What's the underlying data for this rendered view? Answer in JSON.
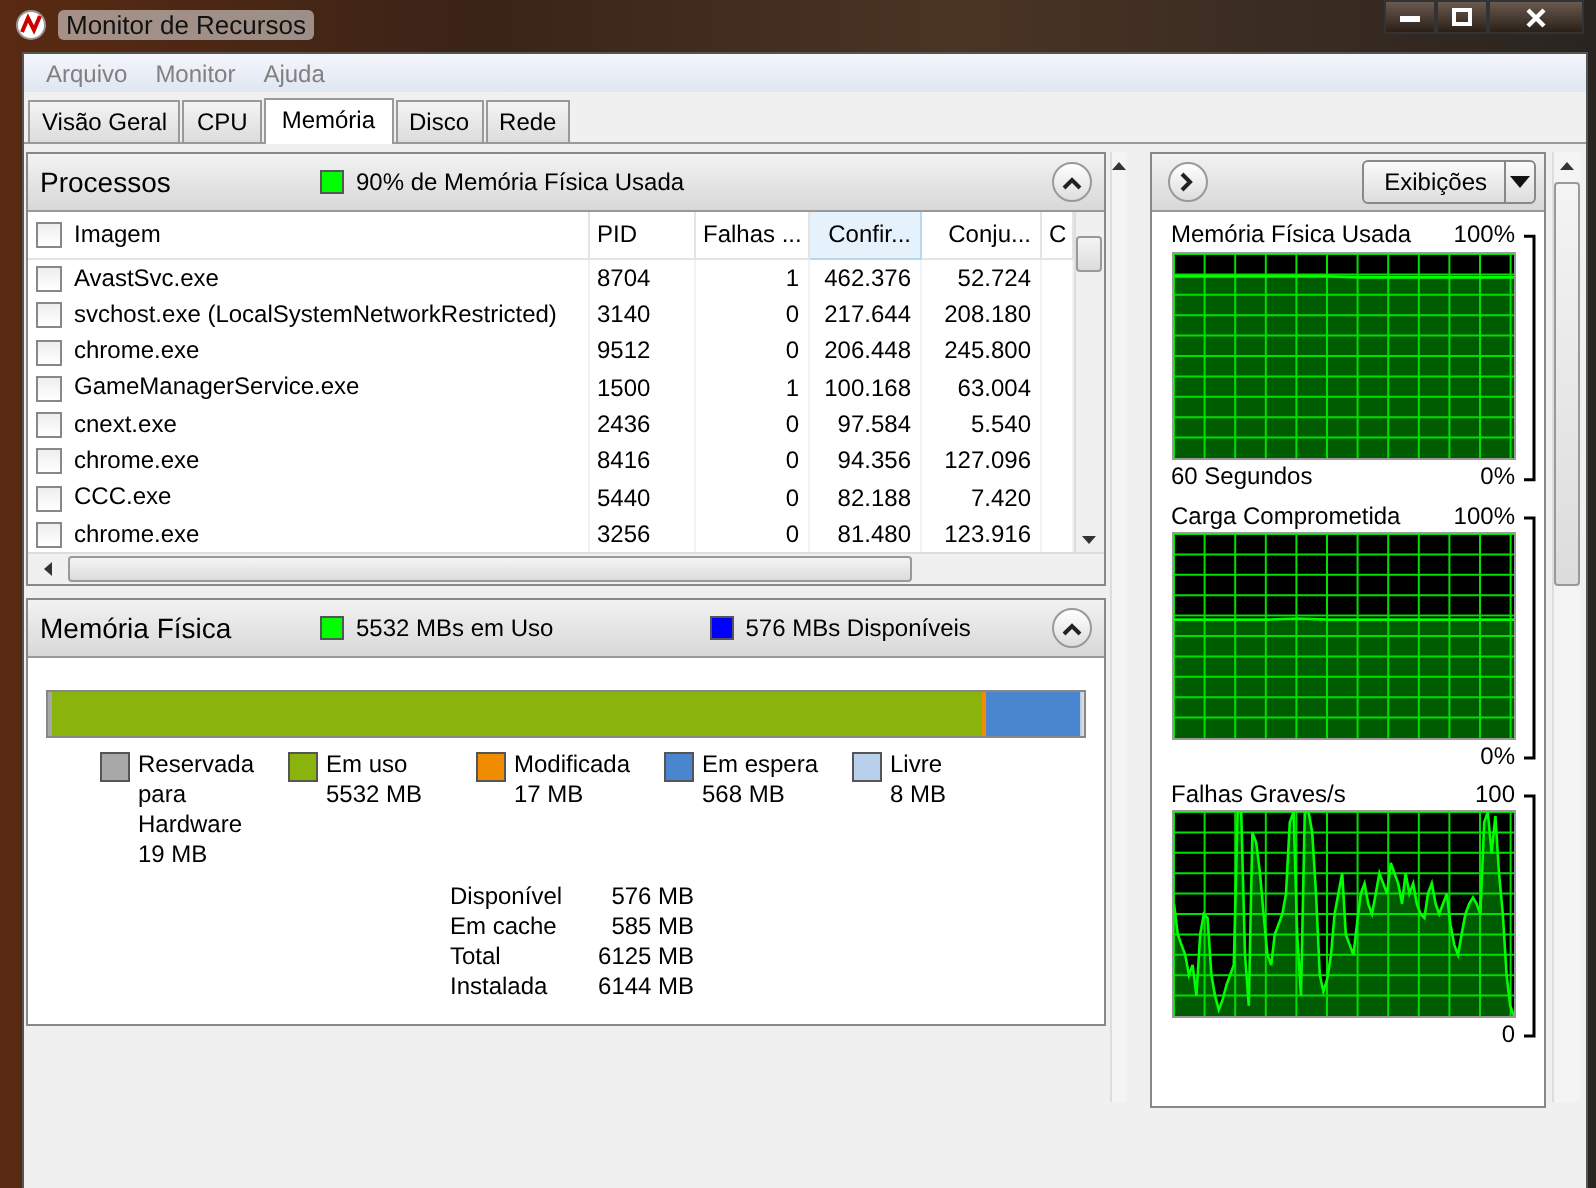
{
  "window": {
    "title": "Monitor de Recursos"
  },
  "menu": [
    "Arquivo",
    "Monitor",
    "Ajuda"
  ],
  "tabs": [
    {
      "label": "Visão Geral",
      "selected": false
    },
    {
      "label": "CPU",
      "selected": false
    },
    {
      "label": "Memória",
      "selected": true
    },
    {
      "label": "Disco",
      "selected": false
    },
    {
      "label": "Rede",
      "selected": false
    }
  ],
  "processes": {
    "title": "Processos",
    "indicator": {
      "label": "90% de Memória Física Usada",
      "color": "#00ff00"
    },
    "expanded": true,
    "columns": [
      {
        "label": "Imagem",
        "sorted": false
      },
      {
        "label": "PID",
        "sorted": false
      },
      {
        "label": "Falhas ...",
        "sorted": false
      },
      {
        "label": "Confir...",
        "sorted": true
      },
      {
        "label": "Conju...",
        "sorted": false
      },
      {
        "label": "C",
        "sorted": false
      }
    ],
    "rows": [
      {
        "checked": false,
        "cells": [
          "AvastSvc.exe",
          "8704",
          "1",
          "462.376",
          "52.724"
        ]
      },
      {
        "checked": false,
        "cells": [
          "svchost.exe (LocalSystemNetworkRestricted)",
          "3140",
          "0",
          "217.644",
          "208.180"
        ]
      },
      {
        "checked": false,
        "cells": [
          "chrome.exe",
          "9512",
          "0",
          "206.448",
          "245.800"
        ]
      },
      {
        "checked": false,
        "cells": [
          "GameManagerService.exe",
          "1500",
          "1",
          "100.168",
          "63.004"
        ]
      },
      {
        "checked": false,
        "cells": [
          "cnext.exe",
          "2436",
          "0",
          "97.584",
          "5.540"
        ]
      },
      {
        "checked": false,
        "cells": [
          "chrome.exe",
          "8416",
          "0",
          "94.356",
          "127.096"
        ]
      },
      {
        "checked": false,
        "cells": [
          "CCC.exe",
          "5440",
          "0",
          "82.188",
          "7.420"
        ]
      },
      {
        "checked": false,
        "cells": [
          "chrome.exe",
          "3256",
          "0",
          "81.480",
          "123.916"
        ]
      }
    ]
  },
  "physical_memory": {
    "title": "Memória Física",
    "expanded": true,
    "indicators": [
      {
        "label": "5532 MBs em Uso",
        "color": "#00ff00"
      },
      {
        "label": "576 MBs Disponíveis",
        "color": "#0000ff"
      }
    ],
    "segments": [
      {
        "label": "Reservada para Hardware",
        "value": "19 MB",
        "color": "#a8a8a8",
        "level": 0.003
      },
      {
        "label": "Em uso",
        "value": "5532 MB",
        "color": "#8ab40c",
        "level": 0.9
      },
      {
        "label": "Modificada",
        "value": "17 MB",
        "color": "#f08c00",
        "level": 0.003
      },
      {
        "label": "Em espera",
        "value": "568 MB",
        "color": "#4a86cf",
        "level": 0.092
      },
      {
        "label": "Livre",
        "value": "8 MB",
        "color": "#b8d0ec",
        "level": 0.002
      }
    ],
    "stats": [
      {
        "label": "Disponível",
        "value": "576 MB"
      },
      {
        "label": "Em cache",
        "value": "585 MB"
      },
      {
        "label": "Total",
        "value": "6125 MB"
      },
      {
        "label": "Instalada",
        "value": "6144 MB"
      }
    ]
  },
  "graphs_panel": {
    "views_button": "Exibições",
    "graphs": [
      {
        "kind": "memory",
        "title": "Memória Física Usada",
        "max_label": "100%",
        "min_label": "0%",
        "time_label": "60 Segundos"
      },
      {
        "kind": "commit",
        "title": "Carga Comprometida",
        "max_label": "100%",
        "min_label": "0%"
      },
      {
        "kind": "faults",
        "title": "Falhas Graves/s",
        "max_label": "100",
        "min_label": "0"
      }
    ]
  }
}
